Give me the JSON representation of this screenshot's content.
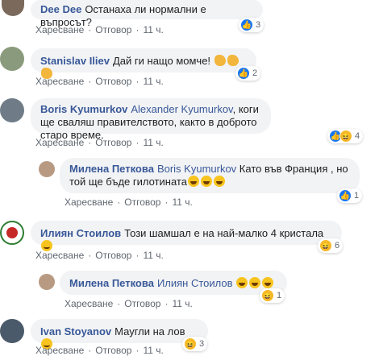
{
  "ui": {
    "like": "Харесване",
    "reply": "Отговор"
  },
  "comments": [
    {
      "name": "Dee Dee",
      "text": "Останаха ли нормални е въпросът?",
      "time": "11 ч.",
      "react_count": "3"
    },
    {
      "name": "Stanislav Iliev",
      "text": "Дай ги нащо момче!",
      "time": "11 ч.",
      "react_count": "2"
    },
    {
      "name": "Boris Kyumurkov",
      "mention": "Alexander Kyumurkov",
      "text": ", коги ще сваляш правителството, както в доброто старо време.",
      "time": "11 ч.",
      "react_count": "4"
    },
    {
      "name": "Милена Петкова",
      "mention": "Boris Kyumurkov",
      "text": " Като във Франция , но той ще бъде гилотината",
      "time": "11 ч.",
      "react_count": "1"
    },
    {
      "name": "Илиян Стоилов",
      "text": "Този шамшал е на най-малко 4 кристала",
      "time": "11 ч.",
      "react_count": "6"
    },
    {
      "name": "Милена Петкова",
      "mention": "Илиян Стоилов",
      "text": "",
      "time": "11 ч.",
      "react_count": "1"
    },
    {
      "name": "Ivan Stoyanov",
      "text": "Маугли на лов",
      "time": "11 ч.",
      "react_count": "3"
    }
  ]
}
